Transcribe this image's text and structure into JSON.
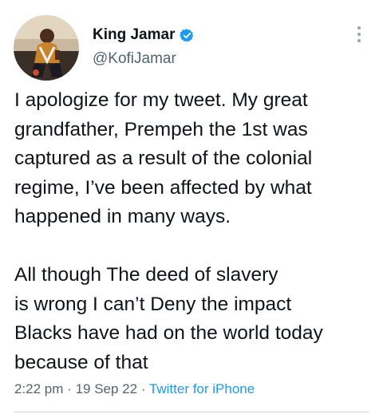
{
  "author": {
    "display_name": "King Jamar",
    "handle": "@KofiJamar",
    "verified": true,
    "avatar_icon": "profile-photo",
    "verified_color": "#1d9bf0"
  },
  "tweet": {
    "lines_para1": [
      "I apologize for my tweet. My great",
      "grandfather, Prempeh the 1st was",
      "captured as a result of the colonial",
      "regime, I’ve been affected by what",
      "happened in many ways."
    ],
    "lines_para2": [
      "All though The deed of slavery",
      "is wrong I can’t Deny the impact",
      "Blacks have had on the world today",
      "because of that"
    ],
    "time": "2:22 pm",
    "date": "19 Sep 22",
    "separator": "·",
    "source": "Twitter for iPhone"
  },
  "colors": {
    "text": "#0f1419",
    "secondary": "#536471",
    "link": "#1d9bf0"
  }
}
